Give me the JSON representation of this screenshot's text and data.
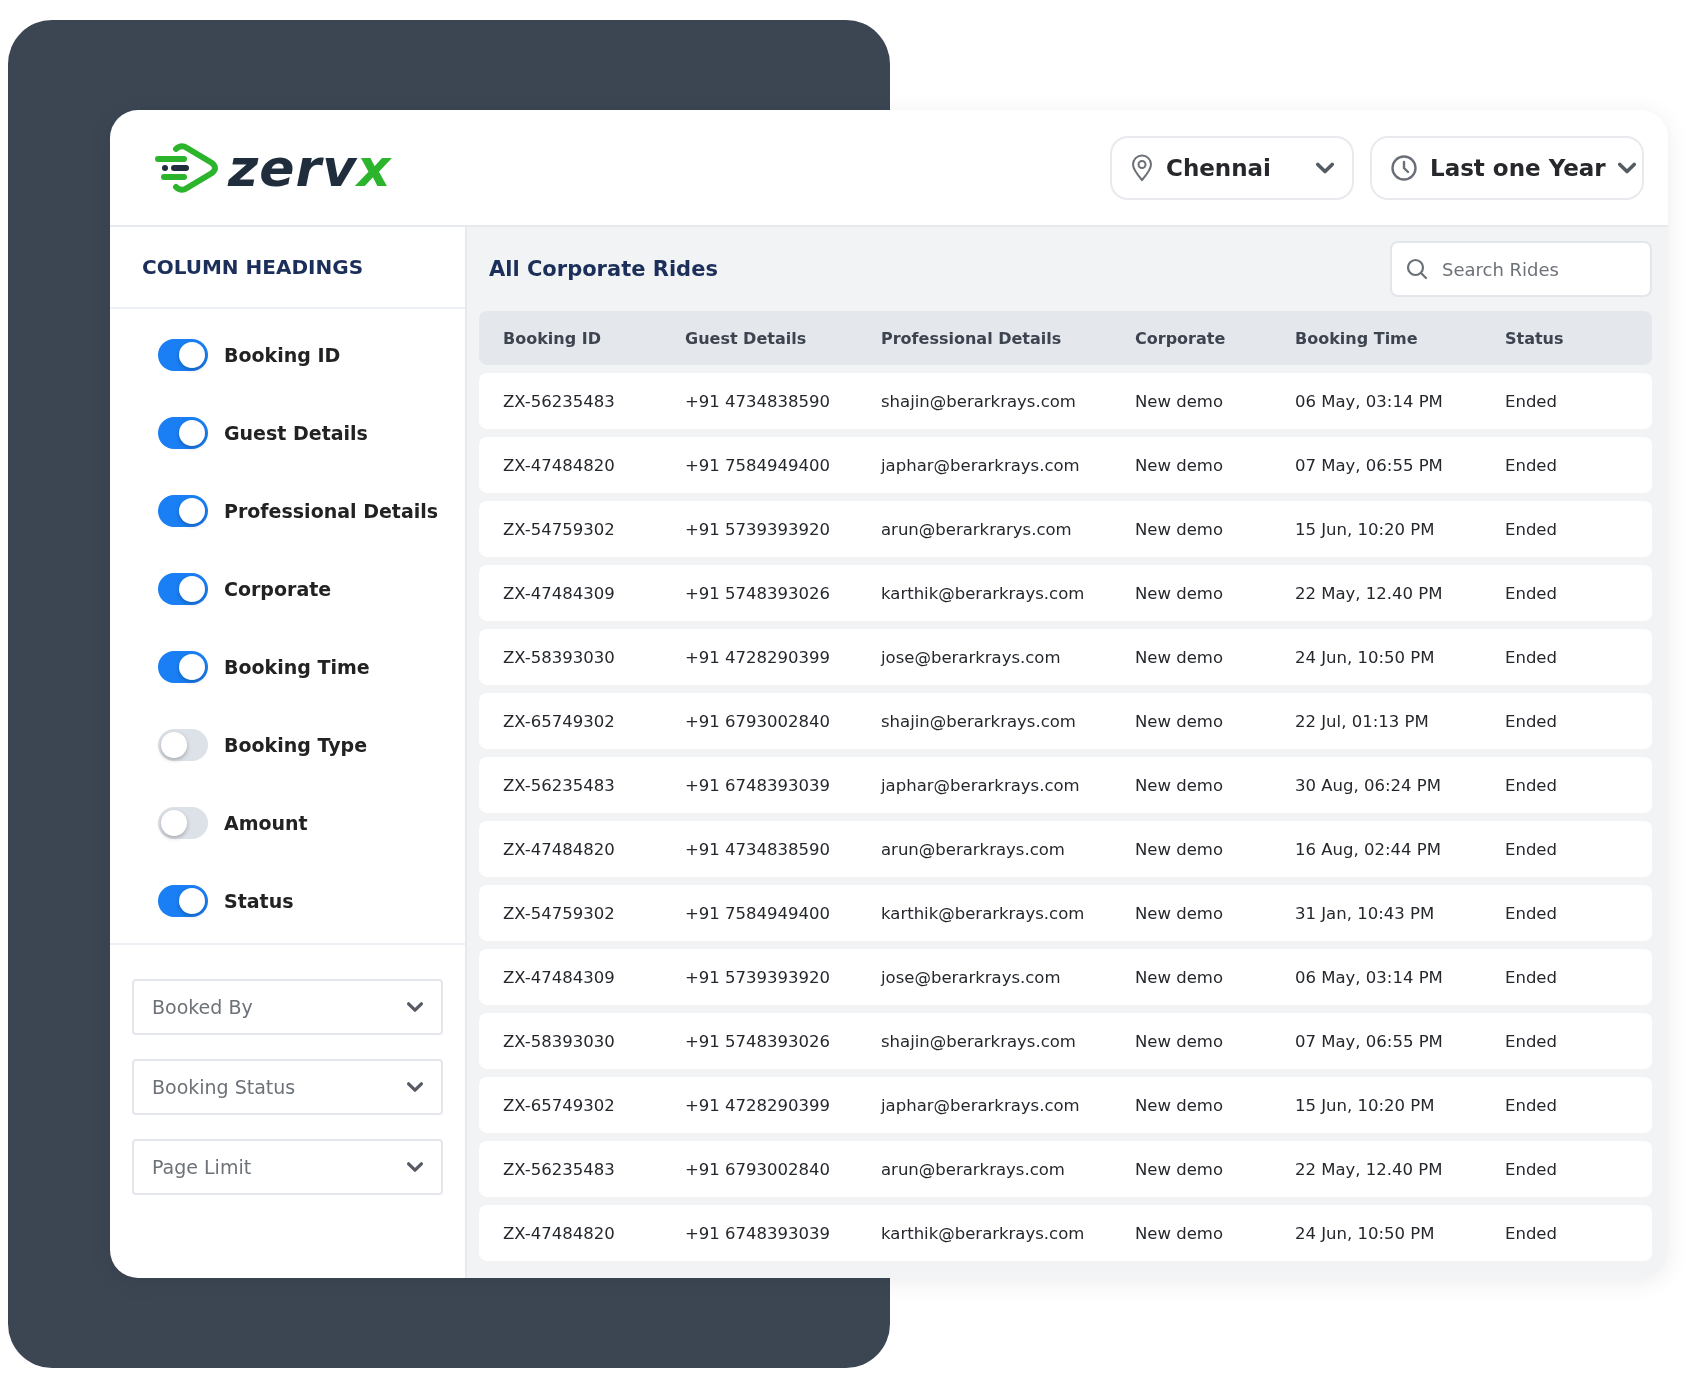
{
  "logo": {
    "text": "zerv",
    "accent": "x"
  },
  "header": {
    "location": {
      "value": "Chennai"
    },
    "period": {
      "value": "Last one Year"
    }
  },
  "sidebar": {
    "title": "COLUMN HEADINGS",
    "toggles": [
      {
        "label": "Booking ID",
        "on": true
      },
      {
        "label": "Guest Details",
        "on": true
      },
      {
        "label": "Professional Details",
        "on": true
      },
      {
        "label": "Corporate",
        "on": true
      },
      {
        "label": "Booking Time",
        "on": true
      },
      {
        "label": "Booking Type",
        "on": false
      },
      {
        "label": "Amount",
        "on": false
      },
      {
        "label": "Status",
        "on": true
      }
    ],
    "filters": [
      {
        "placeholder": "Booked By"
      },
      {
        "placeholder": "Booking Status"
      },
      {
        "placeholder": "Page Limit"
      }
    ]
  },
  "main": {
    "title": "All Corporate Rides",
    "search": {
      "placeholder": "Search Rides"
    },
    "table": {
      "columns": [
        "Booking ID",
        "Guest Details",
        "Professional Details",
        "Corporate",
        "Booking Time",
        "Status"
      ],
      "rows": [
        [
          "ZX-56235483",
          "+91 4734838590",
          "shajin@berarkrays.com",
          "New demo",
          "06 May, 03:14 PM",
          "Ended"
        ],
        [
          "ZX-47484820",
          "+91 7584949400",
          "japhar@berarkrays.com",
          "New demo",
          "07 May, 06:55 PM",
          "Ended"
        ],
        [
          "ZX-54759302",
          "+91 5739393920",
          "arun@berarkrarys.com",
          "New demo",
          "15 Jun, 10:20 PM",
          "Ended"
        ],
        [
          "ZX-47484309",
          "+91 5748393026",
          "karthik@berarkrays.com",
          "New demo",
          "22 May, 12.40 PM",
          "Ended"
        ],
        [
          "ZX-58393030",
          "+91 4728290399",
          "jose@berarkrays.com",
          "New demo",
          "24 Jun, 10:50 PM",
          "Ended"
        ],
        [
          "ZX-65749302",
          "+91 6793002840",
          "shajin@berarkrays.com",
          "New demo",
          "22 Jul, 01:13 PM",
          "Ended"
        ],
        [
          "ZX-56235483",
          "+91 6748393039",
          "japhar@berarkrays.com",
          "New demo",
          "30 Aug, 06:24 PM",
          "Ended"
        ],
        [
          "ZX-47484820",
          "+91 4734838590",
          "arun@berarkrays.com",
          "New demo",
          "16 Aug, 02:44 PM",
          "Ended"
        ],
        [
          "ZX-54759302",
          "+91 7584949400",
          "karthik@berarkrays.com",
          "New demo",
          "31 Jan, 10:43 PM",
          "Ended"
        ],
        [
          "ZX-47484309",
          "+91 5739393920",
          "jose@berarkrays.com",
          "New demo",
          "06 May, 03:14 PM",
          "Ended"
        ],
        [
          "ZX-58393030",
          "+91 5748393026",
          "shajin@berarkrays.com",
          "New demo",
          "07 May, 06:55 PM",
          "Ended"
        ],
        [
          "ZX-65749302",
          "+91 4728290399",
          "japhar@berarkrays.com",
          "New demo",
          "15 Jun, 10:20 PM",
          "Ended"
        ],
        [
          "ZX-56235483",
          "+91 6793002840",
          "arun@berarkrays.com",
          "New demo",
          "22 May, 12.40 PM",
          "Ended"
        ],
        [
          "ZX-47484820",
          "+91 6748393039",
          "karthik@berarkrays.com",
          "New demo",
          "24 Jun, 10:50 PM",
          "Ended"
        ]
      ]
    }
  }
}
